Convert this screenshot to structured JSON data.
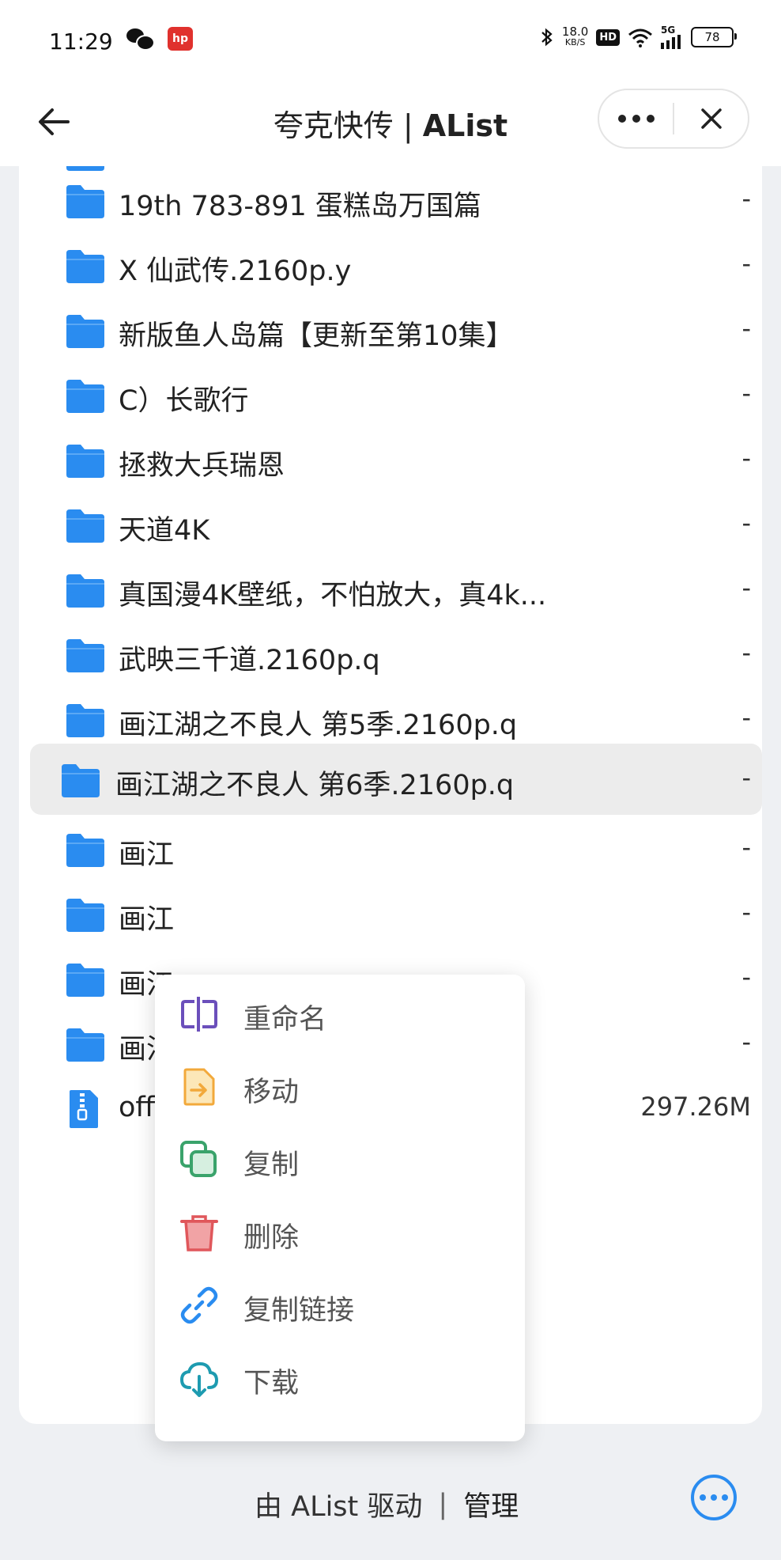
{
  "status_bar": {
    "time": "11:29",
    "hp_label": "hp",
    "net_speed_value": "18.0",
    "net_speed_unit": "KB/S",
    "hd_label": "HD",
    "signal_label": "5G",
    "battery_level": "78"
  },
  "title_bar": {
    "title_main": "夸克快传 | ",
    "title_bold": "AList"
  },
  "files": [
    {
      "name": "19th 783-891 蛋糕岛万国篇",
      "size": "-",
      "type": "folder"
    },
    {
      "name": "X 仙武传.2160p.y",
      "size": "-",
      "type": "folder"
    },
    {
      "name": "新版鱼人岛篇【更新至第10集】",
      "size": "-",
      "type": "folder"
    },
    {
      "name": "C）长歌行",
      "size": "-",
      "type": "folder"
    },
    {
      "name": "拯救大兵瑞恩",
      "size": "-",
      "type": "folder"
    },
    {
      "name": "天道4K",
      "size": "-",
      "type": "folder"
    },
    {
      "name": "真国漫4K壁纸，不怕放大，真4k...",
      "size": "-",
      "type": "folder"
    },
    {
      "name": "武映三千道.2160p.q",
      "size": "-",
      "type": "folder"
    },
    {
      "name": "画江湖之不良人 第5季.2160p.q",
      "size": "-",
      "type": "folder"
    },
    {
      "name": "画江湖之不良人 第6季.2160p.q",
      "size": "-",
      "type": "folder"
    },
    {
      "name": "画江",
      "size": "-",
      "type": "folder"
    },
    {
      "name": "画江",
      "size": "-",
      "type": "folder"
    },
    {
      "name": "画江",
      "size": "-",
      "type": "folder"
    },
    {
      "name": "画江",
      "size": "-",
      "type": "folder"
    },
    {
      "name": "offic",
      "size": "297.26M",
      "type": "zip"
    }
  ],
  "context_menu": {
    "rename": "重命名",
    "move": "移动",
    "copy": "复制",
    "delete": "删除",
    "copy_link": "复制链接",
    "download": "下载"
  },
  "footer": {
    "powered_by": "由 AList 驱动",
    "separator": "|",
    "admin": "管理"
  },
  "colors": {
    "folder_blue": "#2a8cf0",
    "rename_purple": "#6b4fbb",
    "move_orange": "#f2a93b",
    "copy_green": "#3aa36b",
    "delete_red": "#e0575b",
    "link_blue": "#2a8cf0",
    "download_teal": "#1e9bb0"
  }
}
